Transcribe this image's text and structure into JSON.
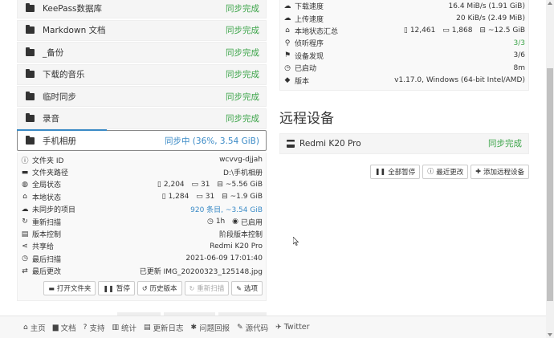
{
  "folders": [
    {
      "name": "KeePass数据库",
      "status": "同步完成"
    },
    {
      "name": "Markdown 文档",
      "status": "同步完成"
    },
    {
      "name": "_备份",
      "status": "同步完成"
    },
    {
      "name": "下载的音乐",
      "status": "同步完成"
    },
    {
      "name": "临时同步",
      "status": "同步完成"
    },
    {
      "name": "录音",
      "status": "同步完成"
    }
  ],
  "open_folder": {
    "name": "手机相册",
    "status": "同步中 (36%, 3.54 GiB)",
    "progress_percent": 36,
    "rows": {
      "id": {
        "label": "文件夹 ID",
        "value": "wcvvg-djjah"
      },
      "path": {
        "label": "文件夹路径",
        "value": "D:\\手机相册"
      },
      "global": {
        "label": "全局状态",
        "files": "2,204",
        "dirs": "31",
        "size": "~5.56 GiB"
      },
      "local": {
        "label": "本地状态",
        "files": "1,284",
        "dirs": "31",
        "size": "~1.9 GiB"
      },
      "out_of_sync": {
        "label": "未同步的项目",
        "value": "920 条目, ~3.54 GiB"
      },
      "rescan": {
        "label": "重新扫描",
        "interval": "1h",
        "watch": "已启用"
      },
      "versioning": {
        "label": "版本控制",
        "value": "阶段版本控制"
      },
      "shared": {
        "label": "共享给",
        "value": "Redmi K20 Pro"
      },
      "last_scan": {
        "label": "最后扫描",
        "value": "2021-06-09 17:01:40"
      },
      "last_change": {
        "label": "最后更改",
        "value": "已更新 IMG_20200323_125148.jpg"
      }
    },
    "buttons": {
      "open": "打开文件夹",
      "pause": "暂停",
      "history": "历史版本",
      "rescan": "重新扫描",
      "options": "选项"
    }
  },
  "this_device": {
    "download": {
      "label": "下载速度",
      "value": "16.4 MiB/s (1.91 GiB)"
    },
    "upload": {
      "label": "上传速度",
      "value": "20 KiB/s (2.49 MiB)"
    },
    "local_total": {
      "label": "本地状态汇总",
      "files": "12,461",
      "dirs": "1,868",
      "size": "~12.5 GiB"
    },
    "listeners": {
      "label": "侦听程序",
      "value": "3/3"
    },
    "discovery": {
      "label": "设备发现",
      "value": "3/6"
    },
    "uptime": {
      "label": "已启动",
      "value": "8m"
    },
    "version": {
      "label": "版本",
      "value": "v1.17.0, Windows (64-bit Intel/AMD)"
    }
  },
  "remote": {
    "title": "远程设备",
    "device": {
      "name": "Redmi K20 Pro",
      "status": "同步完成"
    },
    "buttons": {
      "pause_all": "全部暂停",
      "recent": "最近更改",
      "add": "添加远程设备"
    }
  },
  "footer": [
    "主页",
    "文档",
    "支持",
    "统计",
    "更新日志",
    "问题回报",
    "源代码",
    "Twitter"
  ],
  "colors": {
    "synced": "#3ea54b",
    "syncing": "#3a8ac6"
  }
}
